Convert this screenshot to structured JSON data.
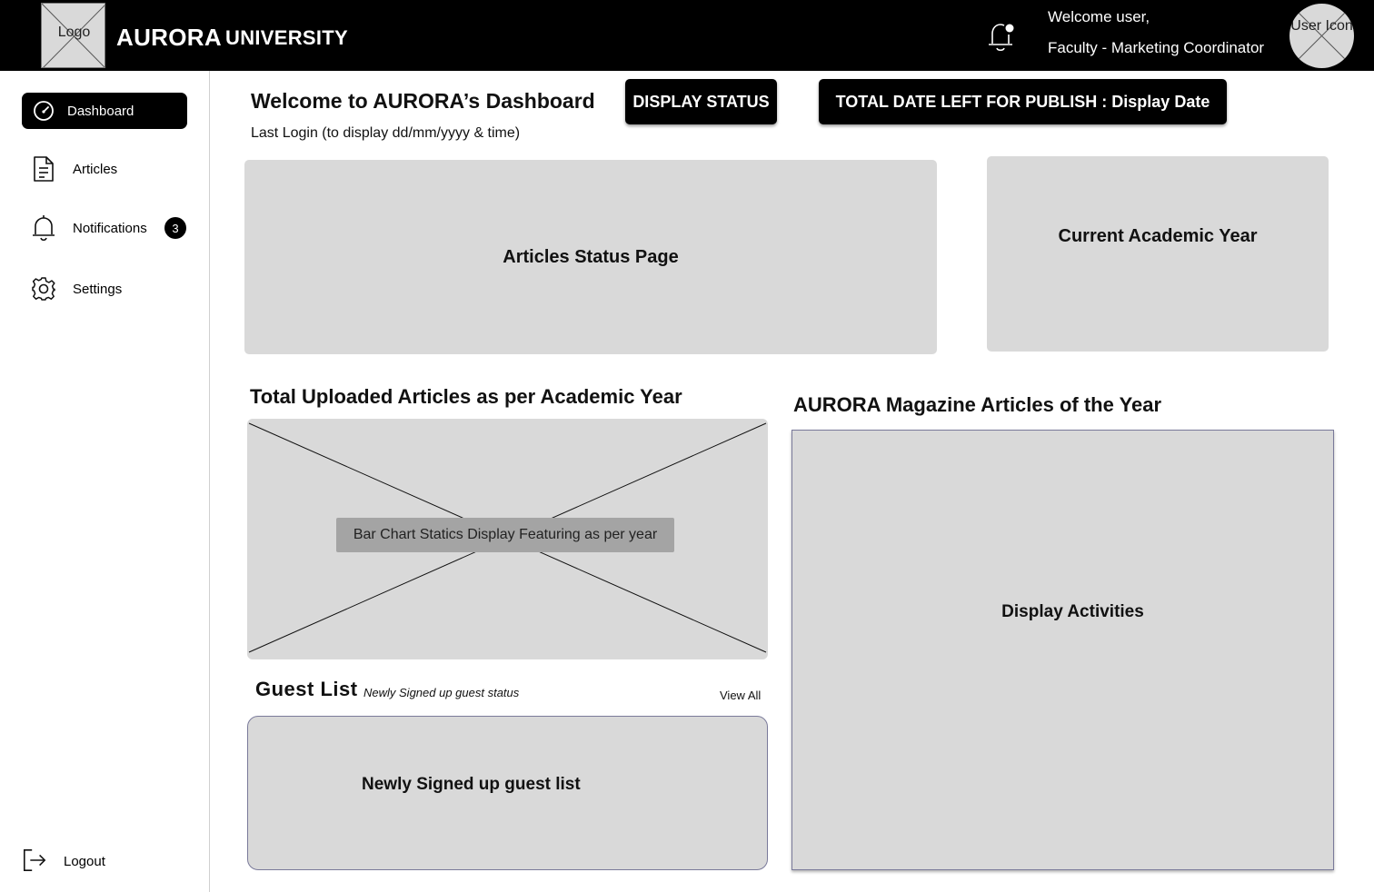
{
  "header": {
    "logo_text": "Logo",
    "brand_primary": "AURORA",
    "brand_secondary": "UNIVERSITY",
    "welcome_line": "Welcome user,",
    "role_line": "Faculty - Marketing Coordinator",
    "user_icon_text": "User Icon"
  },
  "sidebar": {
    "items": [
      {
        "label": "Dashboard",
        "icon": "dashboard-gauge-icon",
        "active": true
      },
      {
        "label": "Articles",
        "icon": "document-icon"
      },
      {
        "label": "Notifications",
        "icon": "bell-icon",
        "badge": "3"
      },
      {
        "label": "Settings",
        "icon": "gear-icon"
      }
    ],
    "logout_label": "Logout"
  },
  "main": {
    "title": "Welcome to AURORA’s Dashboard",
    "last_login": "Last Login  (to display dd/mm/yyyy  & time)",
    "display_status_button": "DISPLAY STATUS",
    "publish_button": "TOTAL DATE LEFT FOR PUBLISH :  Display Date",
    "articles_status_panel": "Articles Status Page",
    "academic_year_panel": "Current Academic Year",
    "uploaded_articles_title": "Total Uploaded Articles as per Academic Year",
    "chart_placeholder_caption": "Bar Chart Statics Display Featuring as per year",
    "magazine_title": "AURORA Magazine Articles of the Year",
    "activities_panel": "Display Activities",
    "guest_list": {
      "title": "Guest  List",
      "subtitle": "Newly Signed up guest status",
      "view_all": "View All",
      "panel_text": "Newly Signed up guest list"
    }
  },
  "colors": {
    "topbar": "#000000",
    "panel": "#d9d9d9",
    "accent": "#000000"
  }
}
